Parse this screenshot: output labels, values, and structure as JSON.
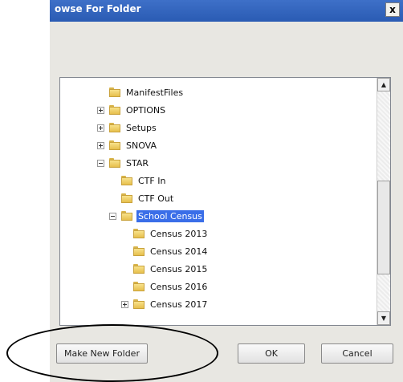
{
  "dialog": {
    "title": "owse For Folder",
    "close_label": "x"
  },
  "tree": {
    "items": [
      {
        "label": "ManifestFiles",
        "expander": "none"
      },
      {
        "label": "OPTIONS",
        "expander": "plus"
      },
      {
        "label": "Setups",
        "expander": "plus"
      },
      {
        "label": "SNOVA",
        "expander": "plus"
      },
      {
        "label": "STAR",
        "expander": "minus"
      },
      {
        "label": "CTF In",
        "expander": "none"
      },
      {
        "label": "CTF Out",
        "expander": "none"
      },
      {
        "label": "School Census",
        "expander": "minus",
        "selected": true
      },
      {
        "label": "Census 2013",
        "expander": "none"
      },
      {
        "label": "Census 2014",
        "expander": "none"
      },
      {
        "label": "Census 2015",
        "expander": "none"
      },
      {
        "label": "Census 2016",
        "expander": "none"
      },
      {
        "label": "Census 2017",
        "expander": "plus"
      }
    ]
  },
  "buttons": {
    "make_new_folder": "Make New Folder",
    "ok": "OK",
    "cancel": "Cancel"
  },
  "scrollbar": {
    "up_icon": "up-arrow-icon",
    "down_icon": "down-arrow-icon"
  },
  "colors": {
    "titlebar": "#2a5bb3",
    "selection": "#3a6ee8",
    "dialog_bg": "#e8e7e2"
  }
}
